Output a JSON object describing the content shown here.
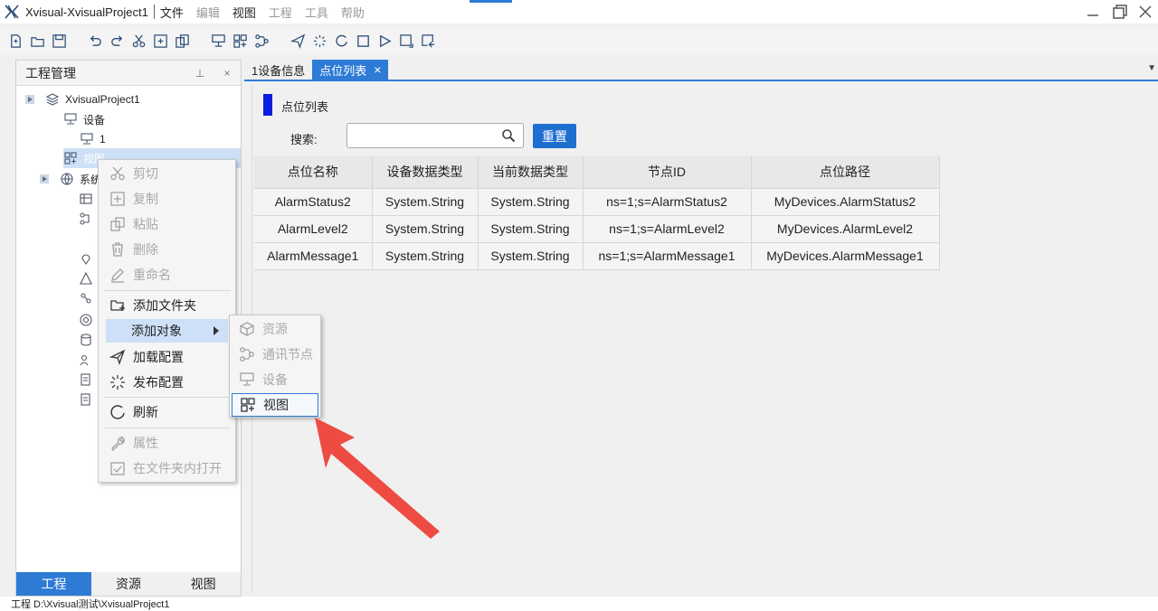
{
  "window": {
    "title": "Xvisual-XvisualProject1",
    "menus": [
      {
        "label": "文件",
        "enabled": true
      },
      {
        "label": "编辑",
        "enabled": false
      },
      {
        "label": "视图",
        "enabled": true
      },
      {
        "label": "工程",
        "enabled": false
      },
      {
        "label": "工具",
        "enabled": false
      },
      {
        "label": "帮助",
        "enabled": false
      }
    ]
  },
  "left_panel": {
    "title": "工程管理",
    "pin_glyph": "⊥",
    "close_glyph": "×",
    "tree": {
      "project": "XvisualProject1",
      "devices_group": "设备",
      "device_1": "1",
      "views_group": "视图",
      "system_group": "系统"
    },
    "bottom_tabs": [
      "工程",
      "资源",
      "视图"
    ]
  },
  "tabs": [
    {
      "label": "1设备信息"
    },
    {
      "label": "点位列表",
      "close": "×"
    }
  ],
  "point_list": {
    "section_title": "点位列表",
    "search_label": "搜索:",
    "search_value": "",
    "reset_label": "重置",
    "columns": [
      "点位名称",
      "设备数据类型",
      "当前数据类型",
      "节点ID",
      "点位路径"
    ],
    "rows": [
      [
        "AlarmStatus2",
        "System.String",
        "System.String",
        "ns=1;s=AlarmStatus2",
        "MyDevices.AlarmStatus2"
      ],
      [
        "AlarmLevel2",
        "System.String",
        "System.String",
        "ns=1;s=AlarmLevel2",
        "MyDevices.AlarmLevel2"
      ],
      [
        "AlarmMessage1",
        "System.String",
        "System.String",
        "ns=1;s=AlarmMessage1",
        "MyDevices.AlarmMessage1"
      ]
    ]
  },
  "context_menu": {
    "items": [
      {
        "label": "剪切",
        "icon": "scissors-icon",
        "enabled": false
      },
      {
        "label": "复制",
        "icon": "copy-icon",
        "enabled": false
      },
      {
        "label": "粘贴",
        "icon": "paste-icon",
        "enabled": false
      },
      {
        "label": "删除",
        "icon": "trash-icon",
        "enabled": false
      },
      {
        "label": "重命名",
        "icon": "pencil-icon",
        "enabled": false
      },
      {
        "label": "添加文件夹",
        "icon": "add-folder-icon",
        "enabled": true
      },
      {
        "label": "添加对象",
        "icon": "",
        "enabled": true,
        "submenu": true
      },
      {
        "label": "加载配置",
        "icon": "load-config-icon",
        "enabled": true
      },
      {
        "label": "发布配置",
        "icon": "publish-config-icon",
        "enabled": true
      },
      {
        "label": "刷新",
        "icon": "refresh-icon",
        "enabled": true
      },
      {
        "label": "属性",
        "icon": "wrench-icon",
        "enabled": false
      },
      {
        "label": "在文件夹内打开",
        "icon": "open-folder-icon",
        "enabled": false
      }
    ],
    "submenu": [
      {
        "label": "资源",
        "icon": "resource-cube-icon",
        "enabled": false
      },
      {
        "label": "通讯节点",
        "icon": "comm-node-icon",
        "enabled": false
      },
      {
        "label": "设备",
        "icon": "device-icon",
        "enabled": false
      },
      {
        "label": "视图",
        "icon": "view-icon",
        "enabled": true,
        "highlighted": true
      }
    ]
  },
  "status_bar": {
    "text": "工程 D:\\Xvisual测试\\XvisualProject1"
  },
  "colors": {
    "accent": "#2e7bd6",
    "button": "#1f6fd1",
    "section_marker": "#0b1ee0",
    "annotation_arrow": "#ee4b43"
  }
}
